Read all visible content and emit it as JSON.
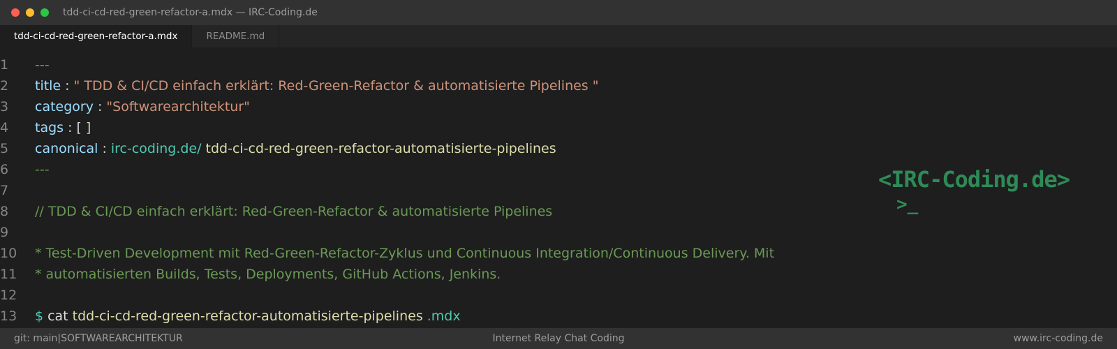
{
  "window": {
    "title": "tdd-ci-cd-red-green-refactor-a.mdx — IRC-Coding.de"
  },
  "tabs": [
    {
      "label": "tdd-ci-cd-red-green-refactor-a.mdx",
      "active": true
    },
    {
      "label": "README.md",
      "active": false
    }
  ],
  "editor": {
    "line_numbers": [
      "1",
      "2",
      "3",
      "4",
      "5",
      "6",
      "7",
      "8",
      "9",
      "10",
      "11",
      "12",
      "13"
    ],
    "l1": "---",
    "l2": {
      "key": "title",
      "sep": ":",
      "value": "\" TDD & CI/CD einfach erklärt: Red-Green-Refactor & automatisierte Pipelines \""
    },
    "l3": {
      "key": "category",
      "sep": ":",
      "value": "\"Softwarearchitektur\""
    },
    "l4": {
      "key": "tags",
      "sep": ":",
      "value": "[ ]"
    },
    "l5": {
      "key": "canonical",
      "sep": ":",
      "domain": "irc-coding.de/",
      "slug": "tdd-ci-cd-red-green-refactor-automatisierte-pipelines"
    },
    "l6": "---",
    "l8": "// TDD & CI/CD einfach erklärt: Red-Green-Refactor & automatisierte Pipelines",
    "l10": "* Test-Driven Development mit Red-Green-Refactor-Zyklus und Continuous Integration/Continuous Delivery. Mit",
    "l11": "* automatisierten Builds, Tests, Deployments, GitHub Actions, Jenkins.",
    "l13": {
      "prompt": "$",
      "cmd": "cat",
      "file": "tdd-ci-cd-red-green-refactor-automatisierte-pipelines",
      "ext": ".mdx"
    }
  },
  "logo": {
    "text": "<IRC-Coding.de>",
    "prompt": ">_"
  },
  "status": {
    "left": "git: main|SOFTWAREARCHITEKTUR",
    "center": "Internet Relay Chat Coding",
    "right": "www.irc-coding.de"
  },
  "colors": {
    "background": "#1e1e1e",
    "key": "#9cdcfe",
    "string": "#ce9178",
    "comment": "#6a9955",
    "teal": "#4ec9b0",
    "logo": "#2e8b57"
  }
}
